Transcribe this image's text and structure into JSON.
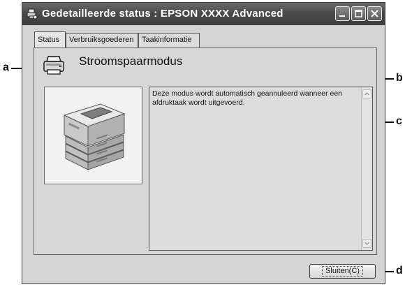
{
  "window": {
    "title": "Gedetailleerde status : EPSON XXXX Advanced"
  },
  "tabs": [
    {
      "label": "Status",
      "active": true
    },
    {
      "label": "Verbruiksgoederen",
      "active": false
    },
    {
      "label": "Taakinformatie",
      "active": false
    }
  ],
  "status": {
    "title": "Stroomspaarmodus",
    "message": "Deze modus wordt automatisch geannuleerd wanneer een afdruktaak wordt uitgevoerd."
  },
  "buttons": {
    "close_label": "Sluiten(C)"
  },
  "callouts": {
    "a": "a",
    "b": "b",
    "c": "c",
    "d": "d"
  },
  "icons": {
    "app": "printer-status-icon",
    "status": "printer-icon",
    "minimize": "minimize-icon",
    "maximize": "maximize-icon",
    "close": "close-icon"
  }
}
